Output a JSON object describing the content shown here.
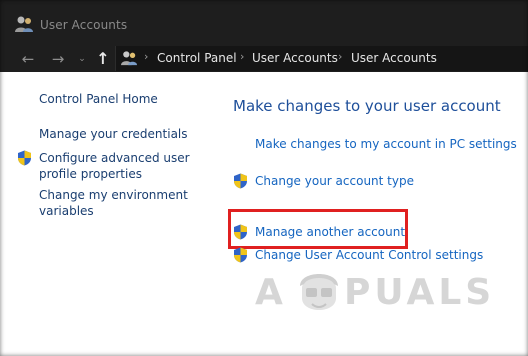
{
  "window": {
    "title": "User Accounts",
    "icon": "user-accounts-icon"
  },
  "nav": {
    "back": "←",
    "forward": "→",
    "recent": "⌄",
    "up": "↑",
    "breadcrumbs": [
      "Control Panel",
      "User Accounts",
      "User Accounts"
    ],
    "separator": "›"
  },
  "sidebar": {
    "home": "Control Panel Home",
    "credentials": "Manage your credentials",
    "advanced_line1": "Configure advanced user",
    "advanced_line2": "profile properties",
    "environment_line1": "Change my environment",
    "environment_line2": "variables"
  },
  "main": {
    "heading": "Make changes to your user account",
    "links": {
      "pc_settings": "Make changes to my account in PC settings",
      "account_type": "Change your account type",
      "manage_another": "Manage another account",
      "uac_settings": "Change User Account Control settings"
    }
  },
  "watermark": {
    "left": "A",
    "right": "PUALS"
  },
  "colors": {
    "titlebar": "#1e1e1e",
    "link": "#1565c0",
    "heading": "#1e4f9a",
    "sidebar_link": "#1a3e70",
    "highlight": "#e02020"
  }
}
